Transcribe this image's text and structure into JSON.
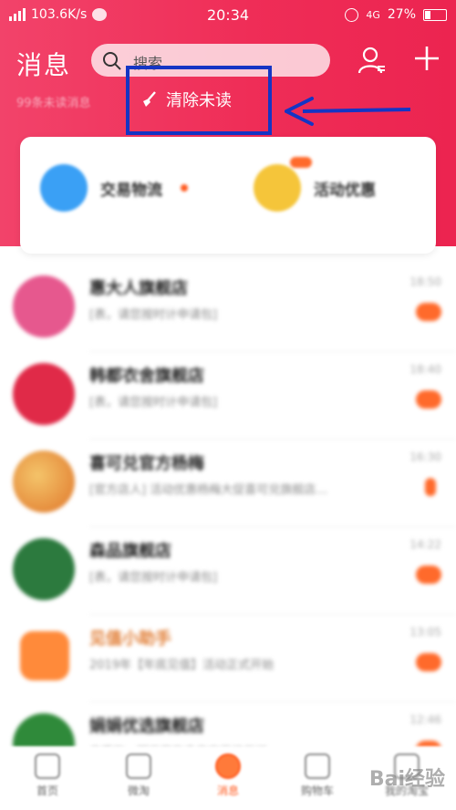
{
  "status_bar": {
    "network_speed": "103.6K/s",
    "time": "20:34",
    "network_type": "4G",
    "battery": "27%"
  },
  "header": {
    "title": "消息",
    "search_placeholder": "搜索",
    "unread_summary": "99条未读消息"
  },
  "toolbar": {
    "clear_unread_label": "清除未读"
  },
  "quick_card": {
    "items": [
      {
        "label": "交易物流",
        "color": "#3aa0f5"
      },
      {
        "label": "活动优惠",
        "color": "#f5c53a"
      }
    ]
  },
  "conversations": [
    {
      "name": "惠大人旗舰店",
      "preview": "[表，请您按时计申请包]",
      "time": "18:50",
      "avatar_color": "#e6588e"
    },
    {
      "name": "韩都衣舍旗舰店",
      "preview": "[表，请您按时计申请包]",
      "time": "18:40",
      "avatar_color": "#e02a48"
    },
    {
      "name": "喜可兑官方杨梅",
      "preview": "[官方店人] 活动优惠杨梅大促喜可兑旗舰店…",
      "time": "16:30",
      "avatar_color": "#e8a23a"
    },
    {
      "name": "森品旗舰店",
      "preview": "[表，请您按时计申请包]",
      "time": "14:22",
      "avatar_color": "#2c7a3e"
    },
    {
      "name": "见值小助手",
      "preview": "2019年【年底见值】活动正式开始",
      "time": "13:05",
      "avatar_color": "#ff8a3a"
    },
    {
      "name": "娟娟优选旗舰店",
      "preview": "亲爱的，明天您有多件宝贝待发送…",
      "time": "12:46",
      "avatar_color": "#2f8a3a"
    }
  ],
  "tabbar": {
    "tabs": [
      {
        "label": "首页"
      },
      {
        "label": "微淘"
      },
      {
        "label": "消息"
      },
      {
        "label": "购物车"
      },
      {
        "label": "我的淘宝"
      }
    ]
  },
  "watermark": "Bai经验",
  "colors": {
    "header_red": "#ef2d57",
    "annotation_blue": "#1535c4",
    "badge_orange": "#ff6a2b"
  }
}
